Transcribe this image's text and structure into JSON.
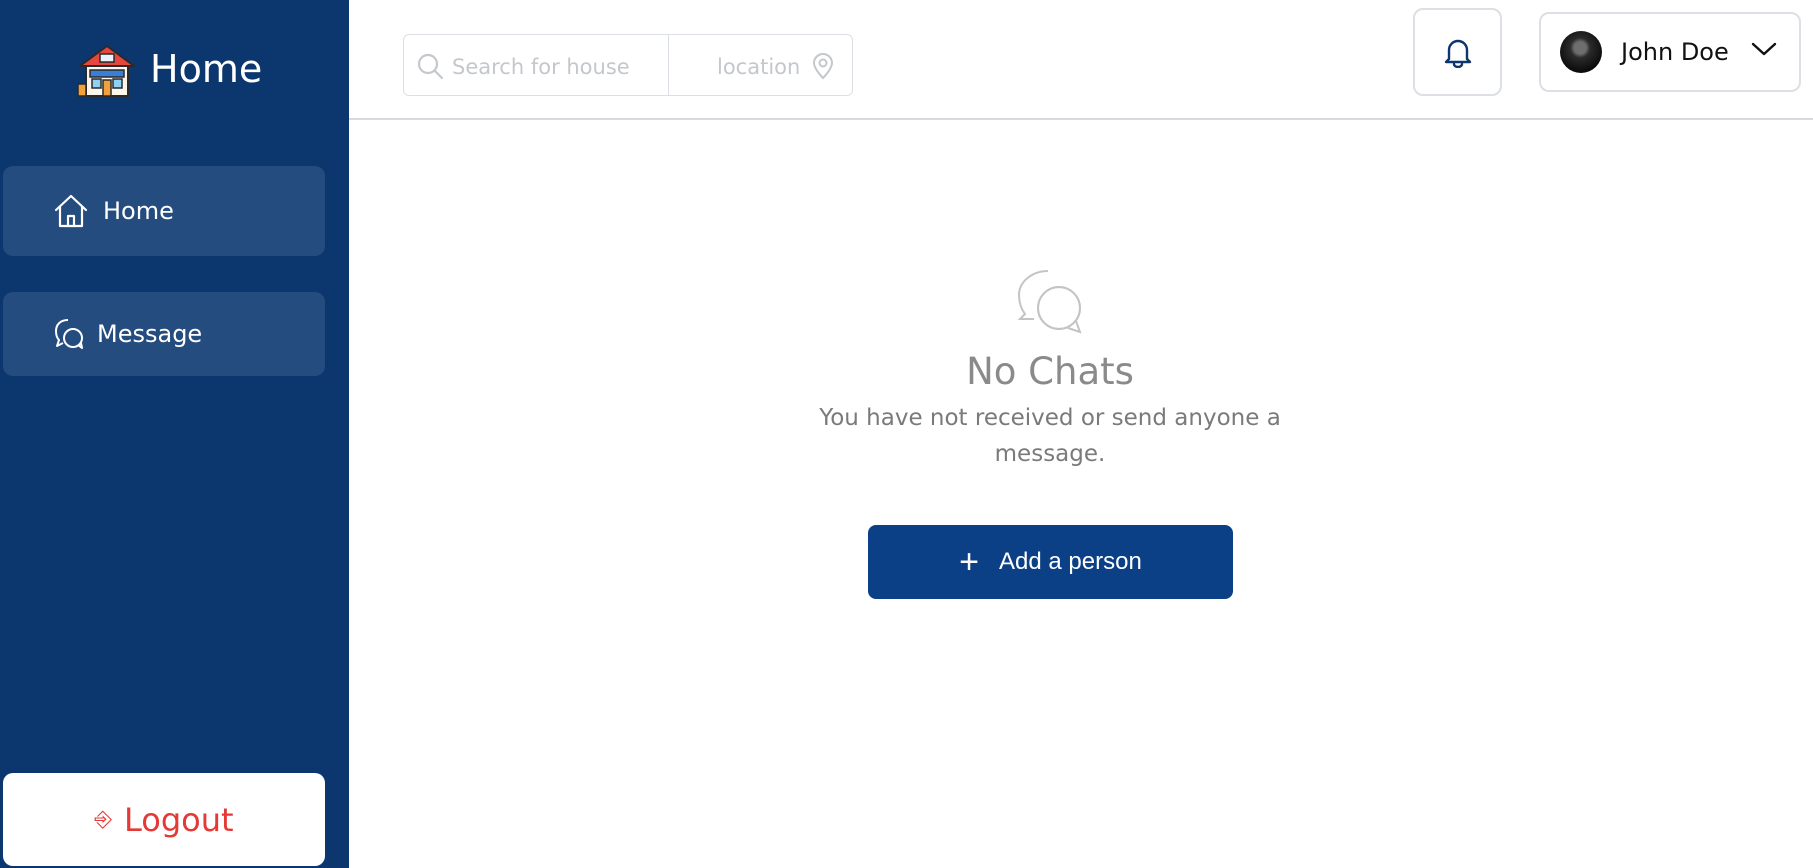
{
  "sidebar": {
    "brand_title": "Home",
    "brand_logo_icon": "house-storefront-icon",
    "items": [
      {
        "label": "Home",
        "icon": "home-icon"
      },
      {
        "label": "Message",
        "icon": "chat-bubble-icon"
      }
    ],
    "logout": {
      "label": "Logout",
      "icon": "logout-icon"
    }
  },
  "header": {
    "search": {
      "placeholder": "Search for house",
      "icon": "search-icon"
    },
    "location": {
      "placeholder": "location",
      "icon": "map-pin-icon"
    },
    "notifications": {
      "icon": "bell-icon"
    },
    "user": {
      "name": "John Doe",
      "icon": "chevron-down-icon"
    }
  },
  "empty_state": {
    "icon": "chat-bubbles-icon",
    "title": "No Chats",
    "description": "You have not received or send anyone a message.",
    "button_label": "Add a person",
    "button_icon": "plus-icon"
  },
  "colors": {
    "sidebar_bg": "#0b366e",
    "nav_item_bg": "#244c7f",
    "primary_button": "#0b3f86",
    "logout_text": "#e53935"
  }
}
